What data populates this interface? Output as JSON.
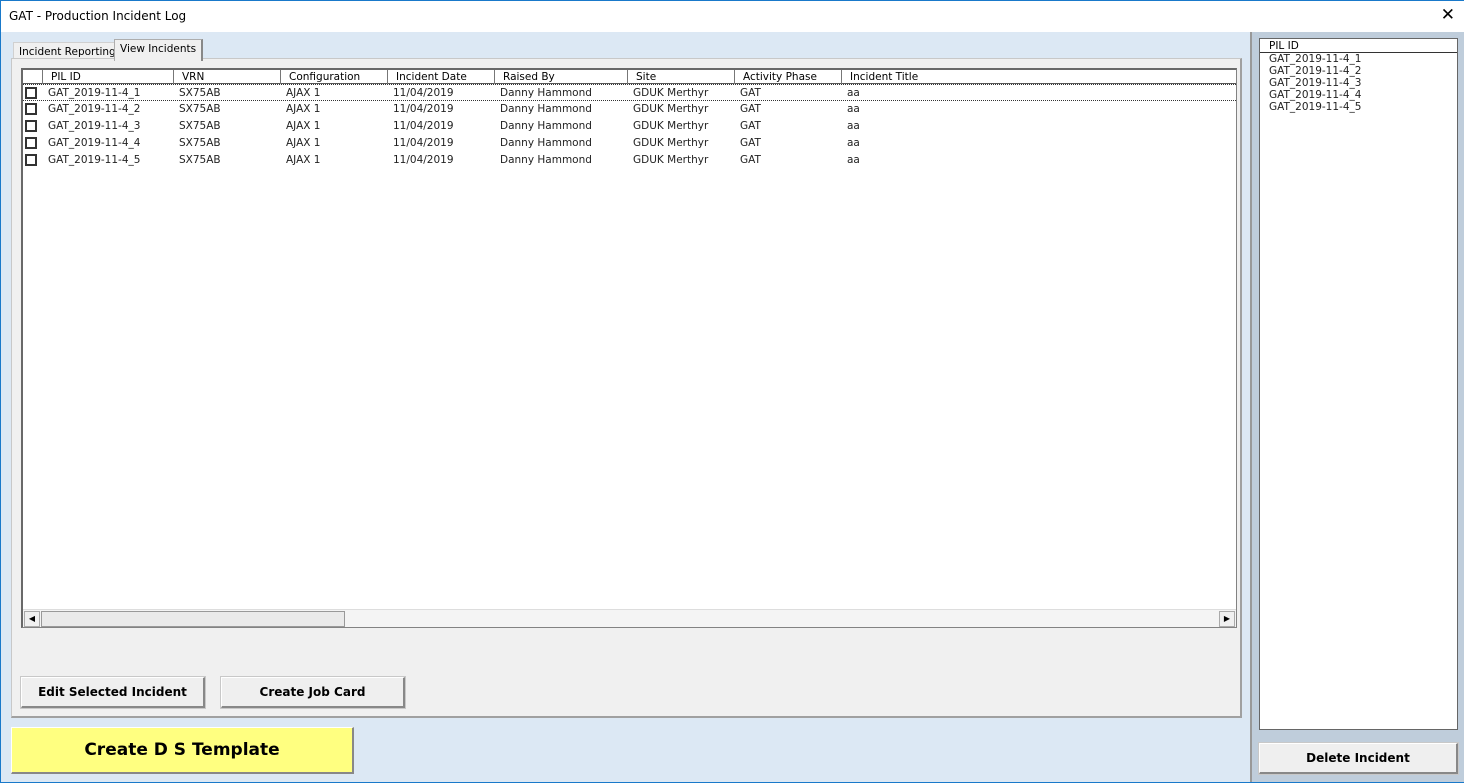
{
  "window": {
    "title": "GAT - Production Incident Log",
    "close_icon": "close-icon"
  },
  "tabs": [
    {
      "label": "Incident Reporting"
    },
    {
      "label": "View Incidents",
      "active": true
    }
  ],
  "table": {
    "columns": [
      "PIL ID",
      "VRN",
      "Configuration",
      "Incident Date",
      "Raised By",
      "Site",
      "Activity Phase",
      "Incident Title"
    ],
    "rows": [
      {
        "checked": false,
        "cells": [
          "GAT_2019-11-4_1",
          "SX75AB",
          "AJAX 1",
          "11/04/2019",
          "Danny Hammond",
          "GDUK Merthyr",
          "GAT",
          "aa"
        ]
      },
      {
        "checked": false,
        "cells": [
          "GAT_2019-11-4_2",
          "SX75AB",
          "AJAX 1",
          "11/04/2019",
          "Danny Hammond",
          "GDUK Merthyr",
          "GAT",
          "aa"
        ]
      },
      {
        "checked": false,
        "cells": [
          "GAT_2019-11-4_3",
          "SX75AB",
          "AJAX 1",
          "11/04/2019",
          "Danny Hammond",
          "GDUK Merthyr",
          "GAT",
          "aa"
        ]
      },
      {
        "checked": false,
        "cells": [
          "GAT_2019-11-4_4",
          "SX75AB",
          "AJAX 1",
          "11/04/2019",
          "Danny Hammond",
          "GDUK Merthyr",
          "GAT",
          "aa"
        ]
      },
      {
        "checked": false,
        "cells": [
          "GAT_2019-11-4_5",
          "SX75AB",
          "AJAX 1",
          "11/04/2019",
          "Danny Hammond",
          "GDUK Merthyr",
          "GAT",
          "aa"
        ]
      }
    ]
  },
  "buttons": {
    "edit": "Edit Selected Incident",
    "job_card": "Create Job Card",
    "template": "Create D     S Template",
    "delete": "Delete Incident"
  },
  "side_list": {
    "header": "PIL ID",
    "items": [
      "GAT_2019-11-4_1",
      "GAT_2019-11-4_2",
      "GAT_2019-11-4_3",
      "GAT_2019-11-4_4",
      "GAT_2019-11-4_5"
    ]
  },
  "colors": {
    "template_button": "#ffff80",
    "window_border": "#1979ca",
    "side_panel": "#bfcddb"
  }
}
